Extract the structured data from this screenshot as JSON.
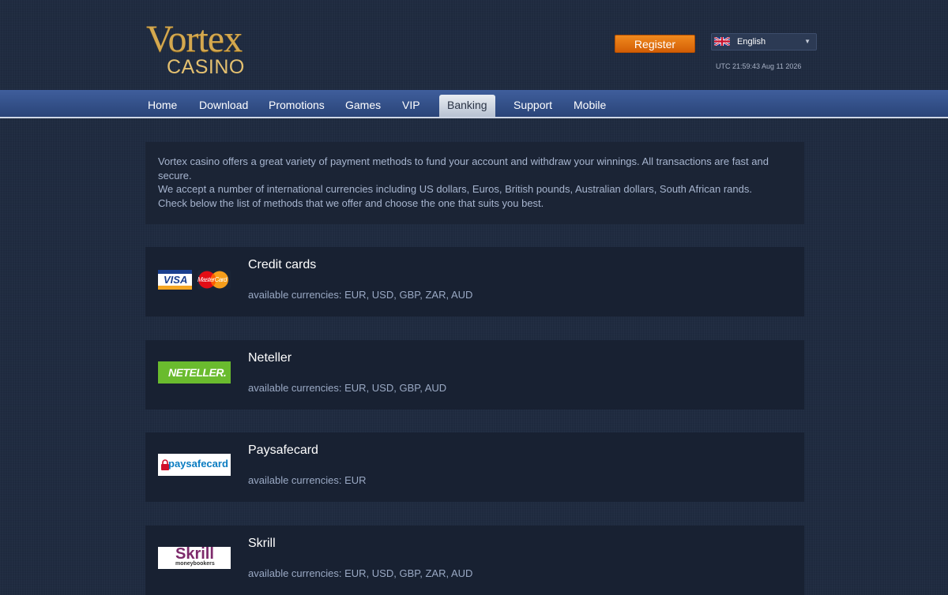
{
  "brand": {
    "name_top": "Vortex",
    "name_bottom": "CASINO"
  },
  "header": {
    "register_label": "Register",
    "language": "English",
    "utc_time": "UTC 21:59:43 Aug 11 2026"
  },
  "nav": {
    "items": [
      {
        "label": "Home"
      },
      {
        "label": "Download"
      },
      {
        "label": "Promotions"
      },
      {
        "label": "Games"
      },
      {
        "label": "VIP"
      },
      {
        "label": "Banking"
      },
      {
        "label": "Support"
      },
      {
        "label": "Mobile"
      }
    ],
    "active": "Banking"
  },
  "intro": {
    "line1": "Vortex casino offers a great variety of payment methods to fund your account and withdraw your winnings. All transactions are fast and secure.",
    "line2": "We accept a number of international currencies including US dollars, Euros, British pounds, Australian dollars, South African rands.",
    "line3": "Check below the list of methods that we offer and choose the one that suits you best."
  },
  "methods": [
    {
      "title": "Credit cards",
      "currencies": "available currencies: EUR, USD, GBP, ZAR, AUD",
      "logos": [
        "VISA",
        "MasterCard"
      ]
    },
    {
      "title": "Neteller",
      "currencies": "available currencies: EUR, USD, GBP, AUD",
      "logos": [
        "NETELLER."
      ]
    },
    {
      "title": "Paysafecard",
      "currencies": "available currencies: EUR",
      "logos": [
        "paysafecard"
      ]
    },
    {
      "title": "Skrill",
      "currencies": "available currencies: EUR, USD, GBP, ZAR, AUD",
      "logos": [
        "Skrill",
        "moneybookers"
      ]
    }
  ],
  "colors": {
    "accent": "#e47410",
    "nav": "#34528a",
    "background": "#1f2b40"
  }
}
